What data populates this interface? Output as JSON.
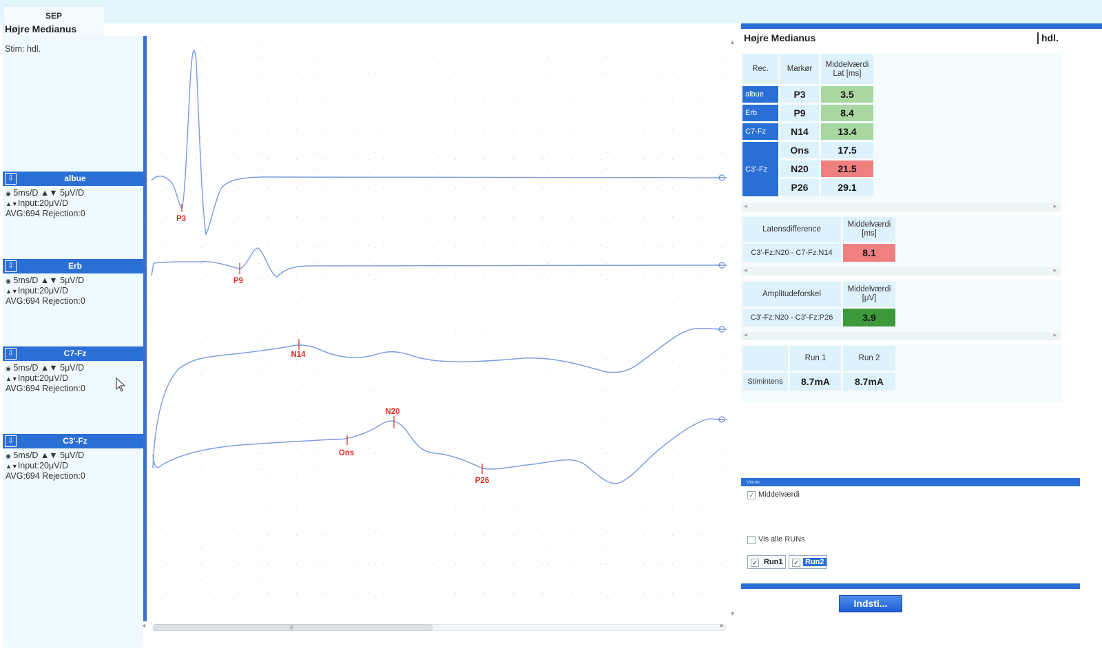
{
  "tab": {
    "title": "SEP",
    "subtitle": "Højre Medianus"
  },
  "stim": "Stim: hdl.",
  "channels": [
    {
      "name": "albue",
      "line1": "5ms/D ▲▼ 5μV/D",
      "line2": "Input:20μV/D",
      "line3": "AVG:694  Rejection:0"
    },
    {
      "name": "Erb",
      "line1": "5ms/D ▲▼ 5μV/D",
      "line2": "Input:20μV/D",
      "line3": "AVG:694  Rejection:0"
    },
    {
      "name": "C7-Fz",
      "line1": "5ms/D ▲▼ 5μV/D",
      "line2": "Input:20μV/D",
      "line3": "AVG:694  Rejection:0"
    },
    {
      "name": "C3'-Fz",
      "line1": "5ms/D ▲▼ 5μV/D",
      "line2": "Input:20μV/D",
      "line3": "AVG:694  Rejection:0"
    }
  ],
  "markers": [
    "P3",
    "P9",
    "N14",
    "Ons",
    "N20",
    "P26"
  ],
  "right": {
    "title": "Højre Medianus",
    "side": "hdl.",
    "latency_table": {
      "headers": [
        "Rec.",
        "Markør",
        "Middelværdi Lat [ms]"
      ],
      "rows": [
        {
          "rec": "albue",
          "marker": "P3",
          "value": "3.5"
        },
        {
          "rec": "Erb",
          "marker": "P9",
          "value": "8.4"
        },
        {
          "rec": "C7-Fz",
          "marker": "N14",
          "value": "13.4"
        },
        {
          "rec": "C3'-Fz",
          "marker": "Ons",
          "value": "17.5"
        },
        {
          "rec": "",
          "marker": "N20",
          "value": "21.5"
        },
        {
          "rec": "",
          "marker": "P26",
          "value": "29.1"
        }
      ]
    },
    "latency_diff": {
      "header": "Latensdifference",
      "unit_header": "Middelværdi [ms]",
      "label": "C3'-Fz:N20 - C7-Fz:N14",
      "value": "8.1"
    },
    "amplitude_diff": {
      "header": "Amplitudeforskel",
      "unit_header": "Middelværdi [μV]",
      "label": "C3'-Fz:N20 - C3'-Fz:P26",
      "value": "3.9"
    },
    "runs": {
      "label": "Stimintens",
      "headers": [
        "Run 1",
        "Run 2"
      ],
      "values": [
        "8.7mA",
        "8.7mA"
      ]
    },
    "options": {
      "title": "Visnin",
      "mean_label": "Middelværdi",
      "show_all_label": "Vis alle RUNs",
      "run1": "Run1",
      "run2": "Run2"
    },
    "settings_button": "Indsti..."
  },
  "colors": {
    "trace": "#7f9fe3",
    "marker": "#e02b20",
    "accent": "#2a6fd6",
    "green": "#a9d7a0",
    "red": "#f08080",
    "dark_green": "#3c9a3a"
  }
}
